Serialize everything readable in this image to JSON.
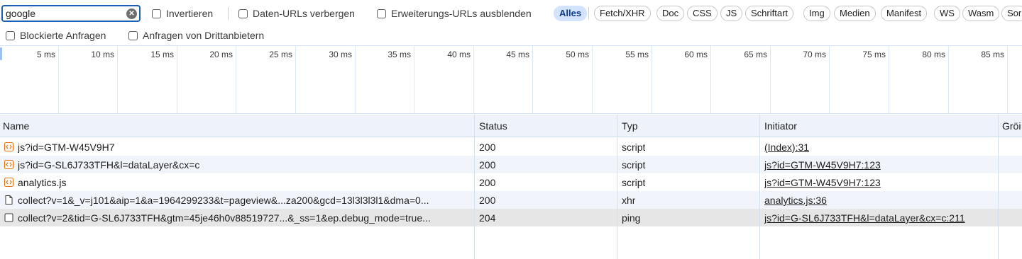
{
  "filter": {
    "search_value": "google",
    "invert_label": "Invertieren",
    "hide_data_urls_label": "Daten-URLs verbergen",
    "hide_extension_urls_label": "Erweiterungs-URLs ausblenden",
    "blocked_requests_label": "Blockierte Anfragen",
    "third_party_label": "Anfragen von Drittanbietern",
    "types": [
      "Alles",
      "Fetch/XHR",
      "Doc",
      "CSS",
      "JS",
      "Schriftart",
      "Img",
      "Medien",
      "Manifest",
      "WS",
      "Wasm",
      "Sor"
    ],
    "active_type": "Alles"
  },
  "timeline": {
    "ticks": [
      "5 ms",
      "10 ms",
      "15 ms",
      "20 ms",
      "25 ms",
      "30 ms",
      "35 ms",
      "40 ms",
      "45 ms",
      "50 ms",
      "55 ms",
      "60 ms",
      "65 ms",
      "70 ms",
      "75 ms",
      "80 ms",
      "85 ms"
    ]
  },
  "table": {
    "headers": {
      "name": "Name",
      "status": "Status",
      "type": "Typ",
      "initiator": "Initiator",
      "size": "Gröi"
    },
    "rows": [
      {
        "icon": "script-icon",
        "name": "js?id=GTM-W45V9H7",
        "status": "200",
        "type": "script",
        "initiator": "(Index):31"
      },
      {
        "icon": "script-icon",
        "name": "js?id=G-SL6J733TFH&l=dataLayer&cx=c",
        "status": "200",
        "type": "script",
        "initiator": "js?id=GTM-W45V9H7:123"
      },
      {
        "icon": "script-icon",
        "name": "analytics.js",
        "status": "200",
        "type": "script",
        "initiator": "js?id=GTM-W45V9H7:123"
      },
      {
        "icon": "document-icon",
        "name": "collect?v=1&_v=j101&aip=1&a=1964299233&t=pageview&...za200&gcd=13l3l3l3l1&dma=0...",
        "status": "200",
        "type": "xhr",
        "initiator": "analytics.js:36"
      },
      {
        "icon": "ping-icon",
        "name": "collect?v=2&tid=G-SL6J733TFH&gtm=45je46h0v88519727...&_ss=1&ep.debug_mode=true...",
        "status": "204",
        "type": "ping",
        "initiator": "js?id=G-SL6J733TFH&l=dataLayer&cx=c:211"
      }
    ]
  },
  "colors": {
    "script_icon": "#e8710a",
    "active_chip_bg": "#d3e3fd",
    "search_border": "#1a5fb4"
  }
}
